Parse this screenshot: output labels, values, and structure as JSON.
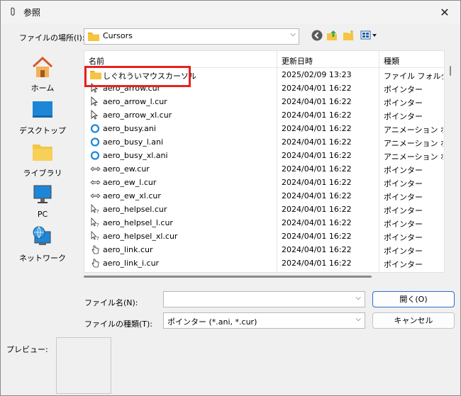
{
  "window": {
    "title": "参照"
  },
  "lookin": {
    "label": "ファイルの場所(I):",
    "value": "Cursors"
  },
  "places": [
    {
      "label": "ホーム"
    },
    {
      "label": "デスクトップ"
    },
    {
      "label": "ライブラリ"
    },
    {
      "label": "PC"
    },
    {
      "label": "ネットワーク"
    }
  ],
  "columns": {
    "name": "名前",
    "date": "更新日時",
    "type": "種類"
  },
  "files": [
    {
      "name": "しぐれういマウスカーソル",
      "date": "2025/02/09 13:23",
      "type": "ファイル フォルダー",
      "icon": "folder-icon"
    },
    {
      "name": "aero_arrow.cur",
      "date": "2024/04/01 16:22",
      "type": "ポインター",
      "icon": "arrow-cursor-icon"
    },
    {
      "name": "aero_arrow_l.cur",
      "date": "2024/04/01 16:22",
      "type": "ポインター",
      "icon": "arrow-cursor-icon"
    },
    {
      "name": "aero_arrow_xl.cur",
      "date": "2024/04/01 16:22",
      "type": "ポインター",
      "icon": "arrow-cursor-icon"
    },
    {
      "name": "aero_busy.ani",
      "date": "2024/04/01 16:22",
      "type": "アニメーション ポインター",
      "icon": "busy-cursor-icon"
    },
    {
      "name": "aero_busy_l.ani",
      "date": "2024/04/01 16:22",
      "type": "アニメーション ポインター",
      "icon": "busy-cursor-icon"
    },
    {
      "name": "aero_busy_xl.ani",
      "date": "2024/04/01 16:22",
      "type": "アニメーション ポインター",
      "icon": "busy-cursor-icon"
    },
    {
      "name": "aero_ew.cur",
      "date": "2024/04/01 16:22",
      "type": "ポインター",
      "icon": "resize-ew-cursor-icon"
    },
    {
      "name": "aero_ew_l.cur",
      "date": "2024/04/01 16:22",
      "type": "ポインター",
      "icon": "resize-ew-cursor-icon"
    },
    {
      "name": "aero_ew_xl.cur",
      "date": "2024/04/01 16:22",
      "type": "ポインター",
      "icon": "resize-ew-cursor-icon"
    },
    {
      "name": "aero_helpsel.cur",
      "date": "2024/04/01 16:22",
      "type": "ポインター",
      "icon": "help-cursor-icon"
    },
    {
      "name": "aero_helpsel_l.cur",
      "date": "2024/04/01 16:22",
      "type": "ポインター",
      "icon": "help-cursor-icon"
    },
    {
      "name": "aero_helpsel_xl.cur",
      "date": "2024/04/01 16:22",
      "type": "ポインター",
      "icon": "help-cursor-icon"
    },
    {
      "name": "aero_link.cur",
      "date": "2024/04/01 16:22",
      "type": "ポインター",
      "icon": "hand-cursor-icon"
    },
    {
      "name": "aero_link_i.cur",
      "date": "2024/04/01 16:22",
      "type": "ポインター",
      "icon": "hand-cursor-icon"
    }
  ],
  "filename": {
    "label": "ファイル名(N):",
    "value": ""
  },
  "filetype": {
    "label": "ファイルの種類(T):",
    "value": "ポインター (*.ani, *.cur)"
  },
  "buttons": {
    "open": "開く(O)",
    "cancel": "キャンセル"
  },
  "preview": {
    "label": "プレビュー:"
  },
  "colors": {
    "highlight": "#e8211f",
    "folder": "#f5c542",
    "accent": "#2a6ccf"
  }
}
